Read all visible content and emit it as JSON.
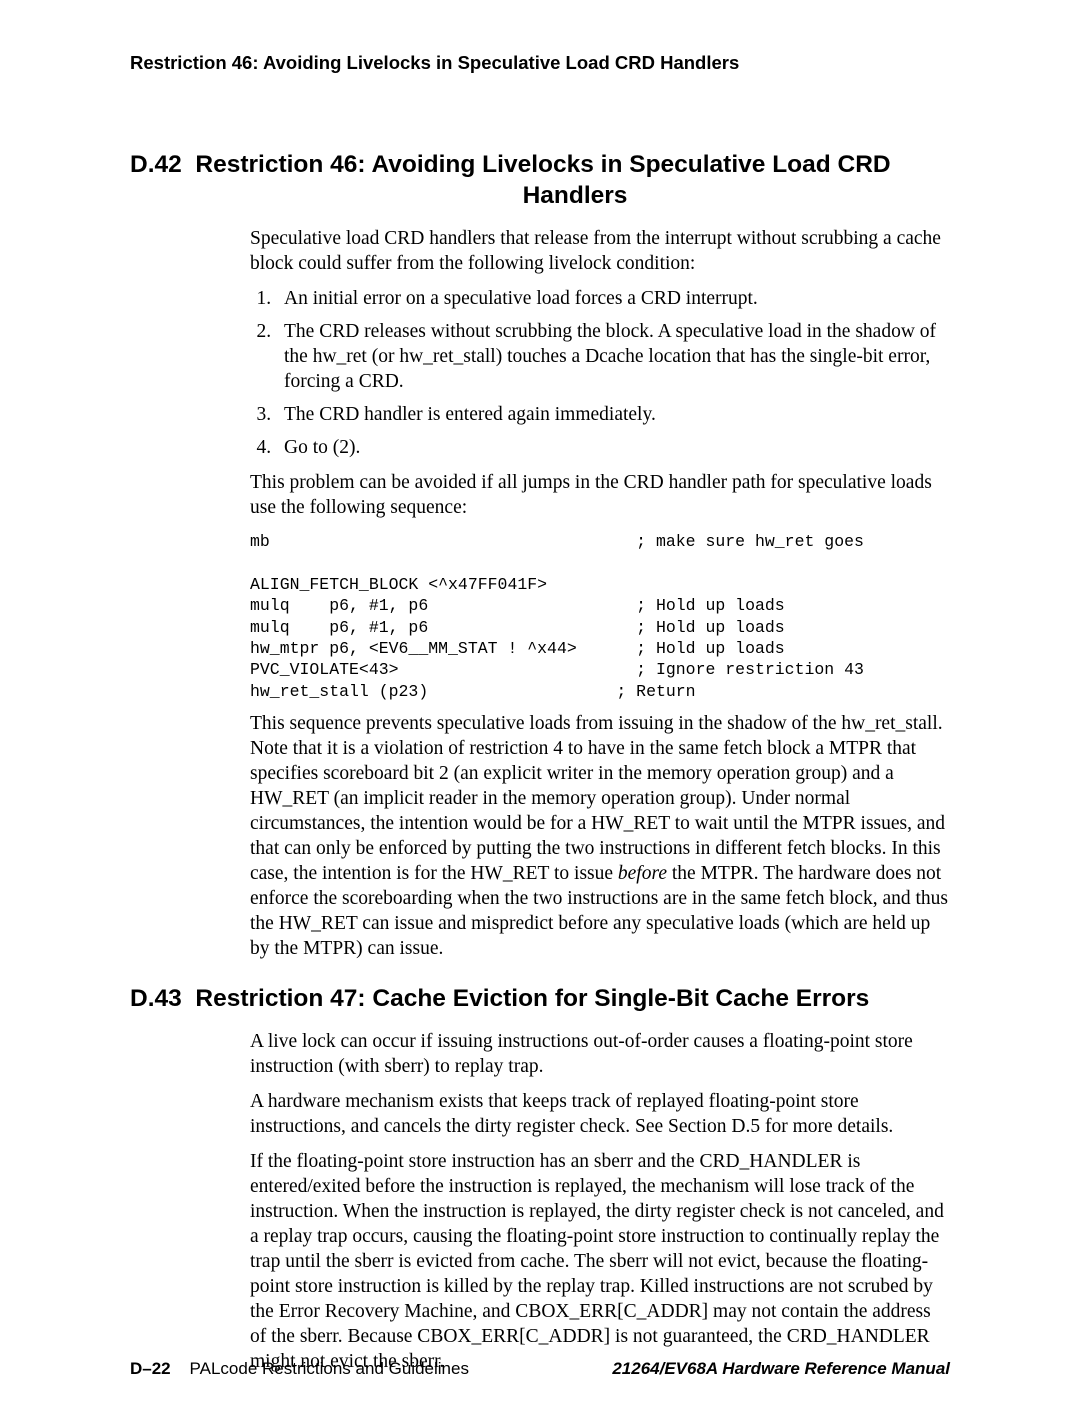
{
  "running_head": "Restriction 46: Avoiding Livelocks in Speculative Load CRD Handlers",
  "section_d42": {
    "number": "D.42",
    "title_line1": "Restriction 46:  Avoiding Livelocks in Speculative Load CRD",
    "title_line2": "Handlers",
    "intro": "Speculative load CRD handlers that release from the interrupt without scrubbing a cache block could suffer from the following livelock condition:",
    "list": [
      "An initial error on a speculative load forces a CRD interrupt.",
      "The CRD releases without scrubbing the block. A speculative load in the shadow of the hw_ret (or hw_ret_stall) touches a Dcache location that has the single-bit error, forcing a CRD.",
      "The CRD handler is entered again immediately.",
      "Go to (2)."
    ],
    "after_list": "This problem can be avoided if all jumps in the CRD handler path for speculative loads use the following sequence:",
    "code": "mb                                     ; make sure hw_ret goes\n\nALIGN_FETCH_BLOCK <^x47FF041F>\nmulq    p6, #1, p6                     ; Hold up loads\nmulq    p6, #1, p6                     ; Hold up loads\nhw_mtpr p6, <EV6__MM_STAT ! ^x44>      ; Hold up loads\nPVC_VIOLATE<43>                        ; Ignore restriction 43\nhw_ret_stall (p23)                   ; Return",
    "after_code_pre": "This sequence prevents speculative loads from issuing in the shadow of the hw_ret_stall. Note that it is a violation of restriction 4 to have  in the same fetch block a MTPR that specifies scoreboard bit 2 (an explicit writer in the memory operation group) and a HW_RET (an implicit reader in the memory operation group). Under normal circumstances, the intention would be for a HW_RET to wait until the MTPR issues, and that can only be enforced by putting the two instructions in different fetch blocks. In this case, the intention is for the HW_RET to issue ",
    "after_code_italic": "before",
    "after_code_post": " the MTPR. The hardware does not enforce the scoreboarding when the two instructions are in the same fetch block, and thus the HW_RET can issue and mispredict before any speculative loads (which are held up by the MTPR) can issue."
  },
  "section_d43": {
    "number": "D.43",
    "title": "Restriction 47:  Cache Eviction for Single-Bit Cache Errors",
    "p1": "A live lock can occur if issuing instructions out-of-order causes a floating-point store instruction (with sberr) to replay trap.",
    "p2": "A hardware mechanism exists that keeps track of replayed floating-point store instructions, and cancels the dirty register check. See Section D.5 for more details.",
    "p3": "If the floating-point store instruction has an sberr and the CRD_HANDLER is entered/exited before the instruction is replayed, the mechanism will lose track of the instruction. When the instruction is replayed, the dirty register check is not canceled, and a replay trap occurs, causing the floating-point store instruction to continually replay the trap until the sberr is evicted from cache. The sberr will not evict, because the floating-point store instruction is killed by the replay trap. Killed instructions are not scrubed by the Error Recovery Machine, and CBOX_ERR[C_ADDR] may not contain the address of the sberr. Because CBOX_ERR[C_ADDR] is not guaranteed, the CRD_HANDLER might not evict the sberr."
  },
  "footer": {
    "page_num": "D–22",
    "left_title": "PALcode Restrictions and Guidelines",
    "right_title": "21264/EV68A Hardware Reference Manual"
  }
}
